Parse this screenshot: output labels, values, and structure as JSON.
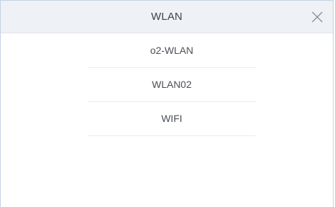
{
  "dialog": {
    "title": "WLAN",
    "close_icon": "close-icon",
    "networks": [
      {
        "label": "o2-WLAN"
      },
      {
        "label": "WLAN02"
      },
      {
        "label": "WIFI"
      }
    ]
  },
  "colors": {
    "header_background": "#eef1f5",
    "border": "#c5d2e2",
    "text": "#4a4f55",
    "divider": "#e8ebef"
  }
}
